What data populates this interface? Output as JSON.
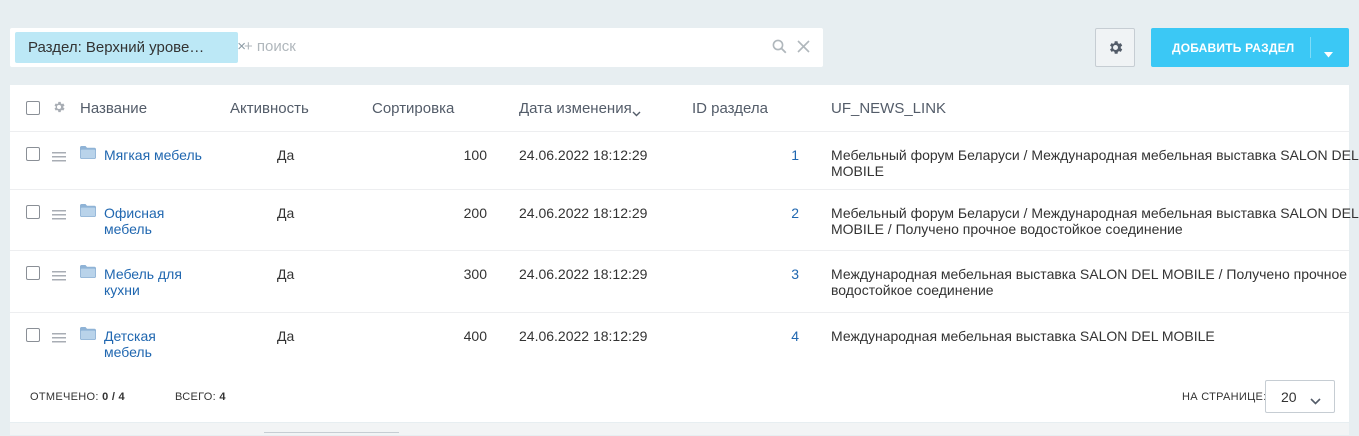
{
  "filter": {
    "chip_label": "Раздел: Верхний урове…",
    "chip_close": "×",
    "search_placeholder": "+ поиск"
  },
  "toolbar": {
    "add_label": "ДОБАВИТЬ РАЗДЕЛ"
  },
  "columns": {
    "name": "Название",
    "active": "Активность",
    "sort": "Сортировка",
    "date": "Дата изменения",
    "id": "ID раздела",
    "uf": "UF_NEWS_LINK"
  },
  "rows": [
    {
      "name": [
        "Мягкая мебель"
      ],
      "active": "Да",
      "sort": "100",
      "date": "24.06.2022 18:12:29",
      "id": "1",
      "uf": [
        "Мебельный форум Беларуси / Международная мебельная выставка SALON DEL",
        "MOBILE"
      ]
    },
    {
      "name": [
        "Офисная",
        "мебель"
      ],
      "active": "Да",
      "sort": "200",
      "date": "24.06.2022 18:12:29",
      "id": "2",
      "uf": [
        "Мебельный форум Беларуси / Международная мебельная выставка SALON DEL",
        "MOBILE / Получено прочное водостойкое соединение"
      ]
    },
    {
      "name": [
        "Мебель для",
        "кухни"
      ],
      "active": "Да",
      "sort": "300",
      "date": "24.06.2022 18:12:29",
      "id": "3",
      "uf": [
        "Международная мебельная выставка SALON DEL MOBILE / Получено прочное",
        "водостойкое соединение"
      ]
    },
    {
      "name": [
        "Детская",
        "мебель"
      ],
      "active": "Да",
      "sort": "400",
      "date": "24.06.2022 18:12:29",
      "id": "4",
      "uf": [
        "Международная мебельная выставка SALON DEL MOBILE"
      ]
    }
  ],
  "footer": {
    "selected_label": "ОТМЕЧЕНО:",
    "selected_value": "0 / 4",
    "total_label": "ВСЕГО:",
    "total_value": "4",
    "per_page_label": "НА СТРАНИЦЕ:",
    "per_page_value": "20"
  },
  "colors": {
    "accent": "#3bc8f5",
    "link": "#2067b0",
    "chip": "#bce8f6",
    "folder": "#8fb3d6"
  }
}
